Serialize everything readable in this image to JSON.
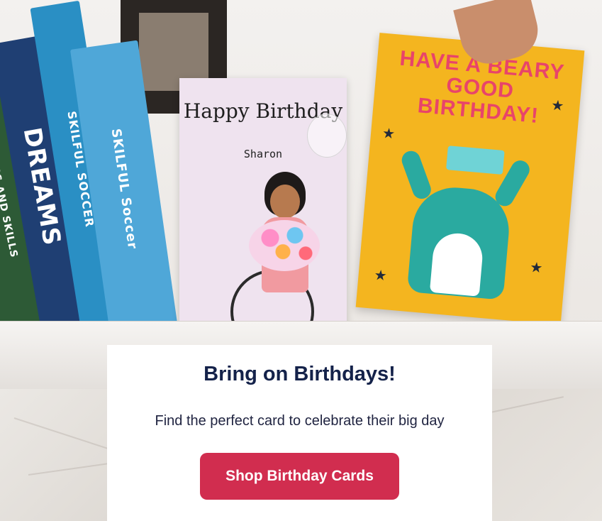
{
  "hero": {
    "books": [
      {
        "spine": "SOCCER TACTICS AND SKILLS"
      },
      {
        "spine": "DREAMS"
      },
      {
        "spine": "SKILFUL SOCCER"
      },
      {
        "spine": "SKILFUL Soccer"
      }
    ],
    "card_left": {
      "greeting": "Happy Birthday",
      "name": "Sharon"
    },
    "card_right": {
      "greeting": "HAVE A BEARY GOOD BIRTHDAY!"
    }
  },
  "promo": {
    "heading": "Bring on Birthdays!",
    "subheading": "Find the perfect card to celebrate their big day",
    "button_label": "Shop Birthday Cards",
    "button_color": "#d12d4f",
    "heading_color": "#14224a"
  }
}
